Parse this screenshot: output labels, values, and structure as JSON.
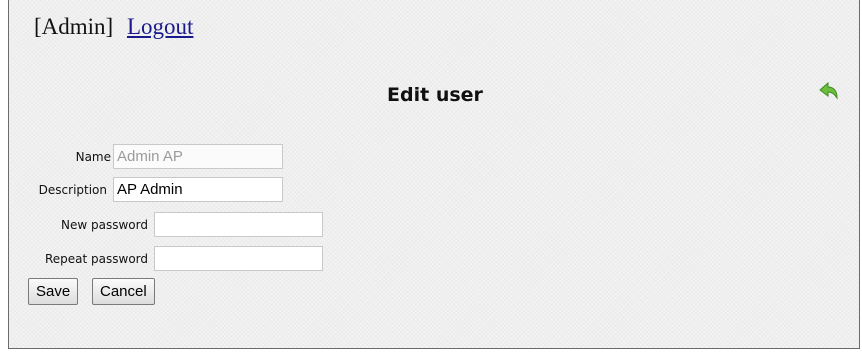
{
  "header": {
    "user": "[Admin]",
    "logout_label": "Logout"
  },
  "page": {
    "title": "Edit user",
    "back_icon": "green-back-arrow-icon"
  },
  "form": {
    "name_label": "Name",
    "name_value": "Admin AP",
    "description_label": "Description",
    "description_value": "AP Admin",
    "new_password_label": "New password",
    "new_password_value": "",
    "repeat_password_label": "Repeat password",
    "repeat_password_value": ""
  },
  "buttons": {
    "save": "Save",
    "cancel": "Cancel"
  },
  "colors": {
    "background": "#efefef",
    "link": "#1a1a8c",
    "icon": "#6cbf3c"
  }
}
